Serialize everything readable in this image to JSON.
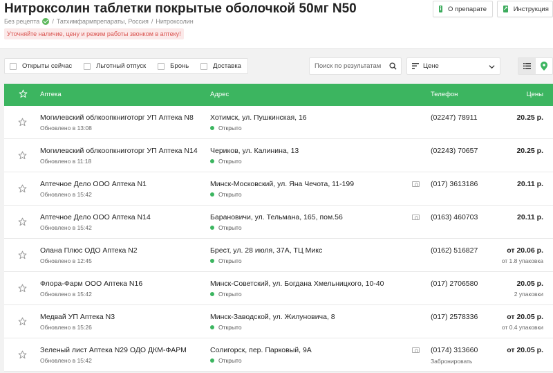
{
  "header": {
    "title": "Нитроксолин таблетки покрытые оболочкой 50мг N50",
    "prescription": "Без рецепта",
    "breadcrumb_sep": "/",
    "manufacturer": "Татхимфармпрепараты, Россия",
    "category": "Нитроксолин",
    "warning": "Уточняйте наличие, цену и режим работы звонком в аптеку!",
    "about_label": "О препарате",
    "instruction_label": "Инструкция"
  },
  "filters": {
    "open_now": "Открыты сейчас",
    "preferential": "Льготный отпуск",
    "reserve": "Бронь",
    "delivery": "Доставка"
  },
  "search": {
    "placeholder": "Поиск по результатам"
  },
  "sort": {
    "label": "Цене"
  },
  "table": {
    "headers": {
      "pharmacy": "Аптека",
      "address": "Адрес",
      "phone": "Телефон",
      "prices": "Цены"
    },
    "rows": [
      {
        "name": "Могилевский облкоопкниготорг УП Аптека N8",
        "updated": "Обновлено в 13:08",
        "address": "Хотимск, ул. Пушкинская, 16",
        "status": "Открыто",
        "cash": false,
        "phone": "(02247) 78911",
        "phone_note": "",
        "price": "20.25 р.",
        "pack": ""
      },
      {
        "name": "Могилевский облкоопкниготорг УП Аптека N14",
        "updated": "Обновлено в 11:18",
        "address": "Чериков, ул. Калинина, 13",
        "status": "Открыто",
        "cash": false,
        "phone": "(02243) 70657",
        "phone_note": "",
        "price": "20.25 р.",
        "pack": ""
      },
      {
        "name": "Аптечное Дело ООО Аптека N1",
        "updated": "Обновлено в 15:42",
        "address": "Минск-Московский, ул. Яна Чечота, 11-199",
        "status": "Открыто",
        "cash": true,
        "phone": "(017) 3613186",
        "phone_note": "",
        "price": "20.11 р.",
        "pack": ""
      },
      {
        "name": "Аптечное Дело ООО Аптека N14",
        "updated": "Обновлено в 15:42",
        "address": "Барановичи, ул. Тельмана, 165, пом.56",
        "status": "Открыто",
        "cash": true,
        "phone": "(0163) 460703",
        "phone_note": "",
        "price": "20.11 р.",
        "pack": ""
      },
      {
        "name": "Олана Плюс ОДО Аптека N2",
        "updated": "Обновлено в 12:45",
        "address": "Брест, ул. 28 июля, 37А, ТЦ Микс",
        "status": "Открыто",
        "cash": false,
        "phone": "(0162) 516827",
        "phone_note": "",
        "price": "от 20.06 р.",
        "pack": "от 1.8 упаковка"
      },
      {
        "name": "Флора-Фарм ООО Аптека N16",
        "updated": "Обновлено в 15:42",
        "address": "Минск-Советский, ул. Богдана Хмельницкого, 10-40",
        "status": "Открыто",
        "cash": false,
        "phone": "(017) 2706580",
        "phone_note": "",
        "price": "20.05 р.",
        "pack": "2 упаковки"
      },
      {
        "name": "Медвай УП Аптека N3",
        "updated": "Обновлено в 15:26",
        "address": "Минск-Заводской, ул. Жилуновича, 8",
        "status": "Открыто",
        "cash": false,
        "phone": "(017) 2578336",
        "phone_note": "",
        "price": "от 20.05 р.",
        "pack": "от 0.4 упаковки"
      },
      {
        "name": "Зеленый лист Аптека N29 ОДО ДКМ-ФАРМ",
        "updated": "Обновлено в 15:42",
        "address": "Солигорск, пер. Парковый, 9А",
        "status": "Открыто",
        "cash": true,
        "phone": "(0174) 313660",
        "phone_note": "Забронировать",
        "price": "от 20.05 р.",
        "pack": ""
      }
    ]
  },
  "colors": {
    "accent": "#3cb560",
    "warning_text": "#d9534f",
    "warning_bg": "#fbe9e9"
  },
  "icons": {
    "verified": "check-circle-icon",
    "favorite": "star-icon",
    "search": "search-icon",
    "sort": "sort-icon",
    "list_view": "list-icon",
    "map_view": "map-pin-icon",
    "cash": "cash-icon"
  }
}
